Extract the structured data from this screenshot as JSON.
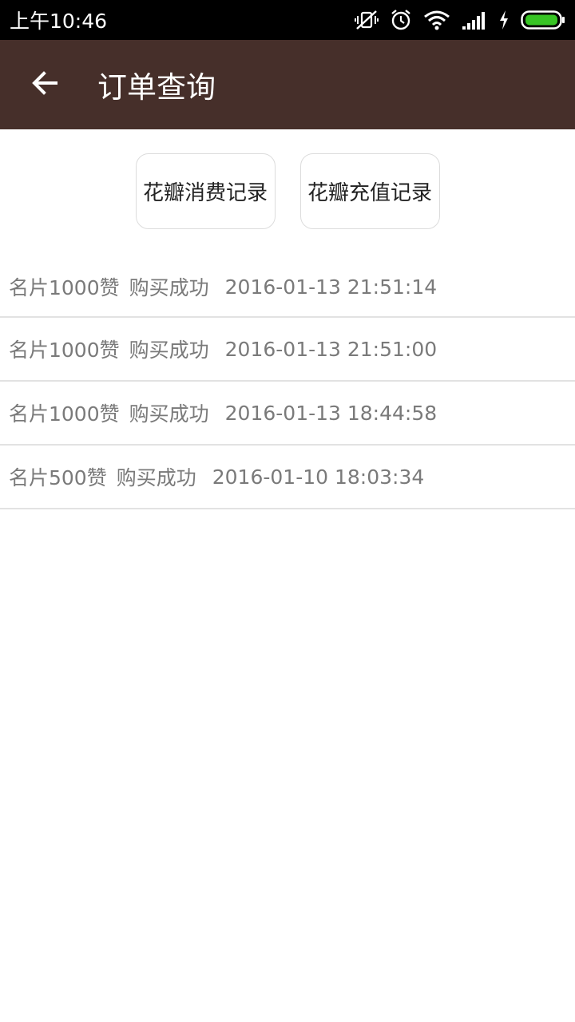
{
  "status_bar": {
    "time": "上午10:46",
    "icons": [
      "vibrate-off-icon",
      "alarm-icon",
      "wifi-icon",
      "signal-icon",
      "charging-icon",
      "battery-icon"
    ]
  },
  "app_bar": {
    "back_icon": "arrow-left-icon",
    "title": "订单查询",
    "background": "#462f2a"
  },
  "tabs": [
    {
      "label": "花瓣消费记录"
    },
    {
      "label": "花瓣充值记录"
    }
  ],
  "orders": [
    {
      "name": "名片1000赞",
      "status": "购买成功",
      "time": "2016-01-13 21:51:14"
    },
    {
      "name": "名片1000赞",
      "status": "购买成功",
      "time": "2016-01-13 21:51:00"
    },
    {
      "name": "名片1000赞",
      "status": "购买成功",
      "time": "2016-01-13 18:44:58"
    },
    {
      "name": "名片500赞",
      "status": "购买成功",
      "time": "2016-01-10 18:03:34"
    }
  ]
}
